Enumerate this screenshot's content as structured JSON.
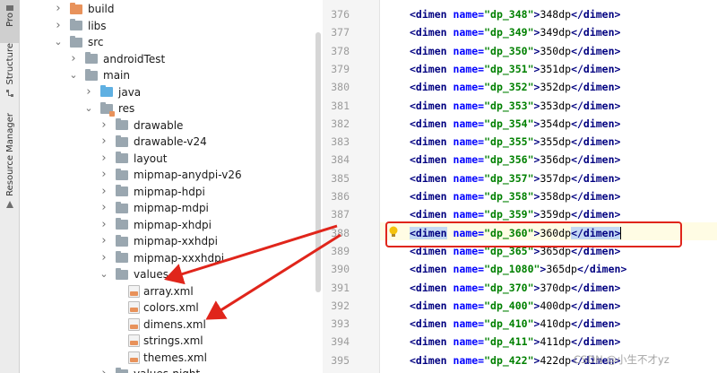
{
  "toolwindows": {
    "project_label": "Pro",
    "structure_label": "Structure",
    "resource_manager_label": "Resource Manager"
  },
  "tree": {
    "items": [
      {
        "label": "build",
        "icon": "folder-orange-icon",
        "expanded": false
      },
      {
        "label": "libs",
        "icon": "folder-icon",
        "expanded": false
      },
      {
        "label": "src",
        "icon": "folder-icon",
        "expanded": true
      },
      {
        "label": "androidTest",
        "icon": "folder-icon",
        "expanded": false
      },
      {
        "label": "main",
        "icon": "folder-icon",
        "expanded": true
      },
      {
        "label": "java",
        "icon": "folder-blue-icon",
        "expanded": false
      },
      {
        "label": "res",
        "icon": "res-folder-icon",
        "expanded": true
      },
      {
        "label": "drawable",
        "icon": "folder-icon",
        "expanded": false
      },
      {
        "label": "drawable-v24",
        "icon": "folder-icon",
        "expanded": false
      },
      {
        "label": "layout",
        "icon": "folder-icon",
        "expanded": false
      },
      {
        "label": "mipmap-anydpi-v26",
        "icon": "folder-icon",
        "expanded": false
      },
      {
        "label": "mipmap-hdpi",
        "icon": "folder-icon",
        "expanded": false
      },
      {
        "label": "mipmap-mdpi",
        "icon": "folder-icon",
        "expanded": false
      },
      {
        "label": "mipmap-xhdpi",
        "icon": "folder-icon",
        "expanded": false
      },
      {
        "label": "mipmap-xxhdpi",
        "icon": "folder-icon",
        "expanded": false
      },
      {
        "label": "mipmap-xxxhdpi",
        "icon": "folder-icon",
        "expanded": false
      },
      {
        "label": "values",
        "icon": "folder-icon",
        "expanded": true
      },
      {
        "label": "array.xml",
        "icon": "xml-file-icon"
      },
      {
        "label": "colors.xml",
        "icon": "xml-file-icon"
      },
      {
        "label": "dimens.xml",
        "icon": "xml-file-icon"
      },
      {
        "label": "strings.xml",
        "icon": "xml-file-icon"
      },
      {
        "label": "themes.xml",
        "icon": "xml-file-icon"
      },
      {
        "label": "values-night",
        "icon": "folder-icon",
        "expanded": false
      }
    ]
  },
  "editor": {
    "lines": [
      {
        "no": "376",
        "name": "dp_348",
        "value": "348dp"
      },
      {
        "no": "377",
        "name": "dp_349",
        "value": "349dp"
      },
      {
        "no": "378",
        "name": "dp_350",
        "value": "350dp"
      },
      {
        "no": "379",
        "name": "dp_351",
        "value": "351dp"
      },
      {
        "no": "380",
        "name": "dp_352",
        "value": "352dp"
      },
      {
        "no": "381",
        "name": "dp_353",
        "value": "353dp"
      },
      {
        "no": "382",
        "name": "dp_354",
        "value": "354dp"
      },
      {
        "no": "383",
        "name": "dp_355",
        "value": "355dp"
      },
      {
        "no": "384",
        "name": "dp_356",
        "value": "356dp"
      },
      {
        "no": "385",
        "name": "dp_357",
        "value": "357dp"
      },
      {
        "no": "386",
        "name": "dp_358",
        "value": "358dp"
      },
      {
        "no": "387",
        "name": "dp_359",
        "value": "359dp"
      },
      {
        "no": "388",
        "name": "dp_360",
        "value": "360dp",
        "selected": true
      },
      {
        "no": "389",
        "name": "dp_365",
        "value": "365dp"
      },
      {
        "no": "390",
        "name": "dp_1080",
        "value": "365dp"
      },
      {
        "no": "391",
        "name": "dp_370",
        "value": "370dp"
      },
      {
        "no": "392",
        "name": "dp_400",
        "value": "400dp"
      },
      {
        "no": "393",
        "name": "dp_410",
        "value": "410dp"
      },
      {
        "no": "394",
        "name": "dp_411",
        "value": "411dp"
      },
      {
        "no": "395",
        "name": "dp_422",
        "value": "422dp"
      }
    ],
    "tag_open": "<dimen",
    "attr_name": "name=",
    "tag_close": "</dimen>"
  },
  "watermark": "CSDN @小生不才yz",
  "colors": {
    "annotation_red": "#e0251b",
    "tag": "#000080",
    "attr": "#0000ff",
    "string": "#008000",
    "selection": "#c3d9f3",
    "current_line": "#fffce4"
  }
}
